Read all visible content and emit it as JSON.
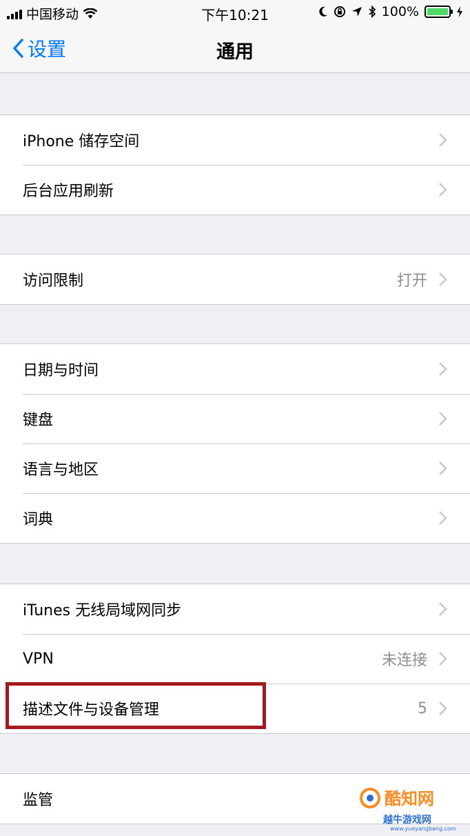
{
  "status_bar": {
    "carrier": "中国移动",
    "time": "下午10:21",
    "battery_percent": "100%",
    "battery_level": 1.0,
    "icons": [
      "signal-icon",
      "wifi-icon",
      "moon-icon",
      "orientation-lock-icon",
      "location-icon",
      "bluetooth-icon",
      "battery-icon",
      "charging-icon"
    ]
  },
  "nav": {
    "back_label": "设置",
    "title": "通用"
  },
  "groups": [
    {
      "items": [
        {
          "label": "iPhone 储存空间",
          "value": ""
        },
        {
          "label": "后台应用刷新",
          "value": ""
        }
      ]
    },
    {
      "items": [
        {
          "label": "访问限制",
          "value": "打开"
        }
      ]
    },
    {
      "items": [
        {
          "label": "日期与时间",
          "value": ""
        },
        {
          "label": "键盘",
          "value": ""
        },
        {
          "label": "语言与地区",
          "value": ""
        },
        {
          "label": "词典",
          "value": ""
        }
      ]
    },
    {
      "items": [
        {
          "label": "iTunes 无线局域网同步",
          "value": ""
        },
        {
          "label": "VPN",
          "value": "未连接"
        },
        {
          "label": "描述文件与设备管理",
          "value": "5"
        }
      ]
    },
    {
      "items": [
        {
          "label": "监管",
          "value": ""
        }
      ]
    }
  ],
  "watermark": {
    "text": "酷知网",
    "sub": "越牛游戏网",
    "url": "www.yueyangbang.com"
  },
  "colors": {
    "accent": "#007aff",
    "highlight": "#a3191e",
    "background": "#efeff4"
  }
}
